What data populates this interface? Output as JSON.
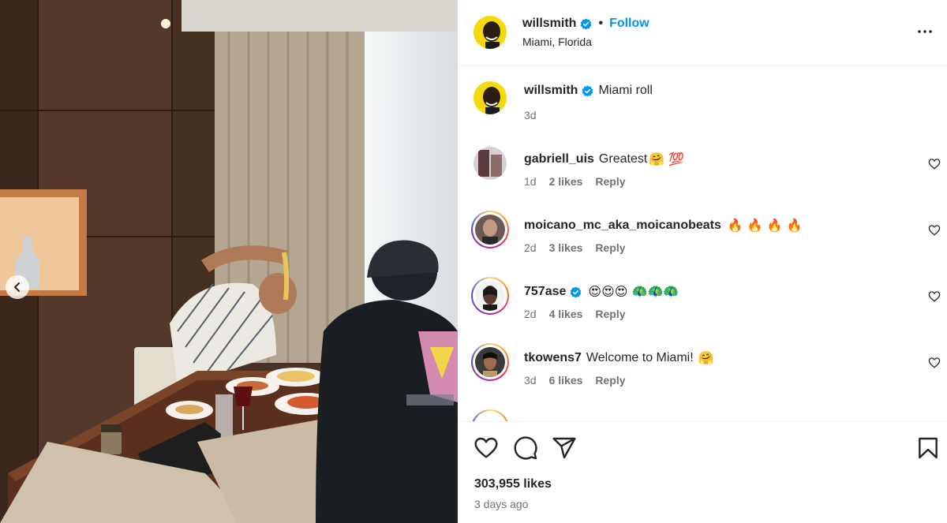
{
  "post": {
    "username": "willsmith",
    "follow_label": "Follow",
    "separator": "•",
    "location": "Miami, Florida",
    "caption": "Miami roll",
    "caption_time": "3d",
    "likes": "303,955 likes",
    "time_ago": "3 days ago"
  },
  "comments": [
    {
      "username": "gabriell_uis",
      "text": "Greatest",
      "emoji": "🤗 💯",
      "time": "1d",
      "likes": "2 likes",
      "reply": "Reply",
      "verified": false
    },
    {
      "username": "moicano_mc_aka_moicanobeats",
      "text": "",
      "emoji": "🔥 🔥 🔥 🔥",
      "time": "2d",
      "likes": "3 likes",
      "reply": "Reply",
      "verified": false
    },
    {
      "username": "757ase",
      "text": "",
      "emoji": "😍😍😍 🦚🦚🦚",
      "time": "2d",
      "likes": "4 likes",
      "reply": "Reply",
      "verified": true
    },
    {
      "username": "tkowens7",
      "text": "Welcome to Miami!",
      "emoji": "🤗",
      "time": "3d",
      "likes": "6 likes",
      "reply": "Reply",
      "verified": false
    }
  ],
  "icons": {
    "verified": "verified-badge-icon",
    "more": "more-options-icon",
    "like": "heart-icon",
    "comment": "comment-icon",
    "share": "send-icon",
    "save": "bookmark-icon",
    "prev": "chevron-left-icon"
  },
  "colors": {
    "accent": "#0095f6",
    "text": "#262626",
    "muted": "#737373",
    "avatar_bg": "#f5d90a"
  }
}
